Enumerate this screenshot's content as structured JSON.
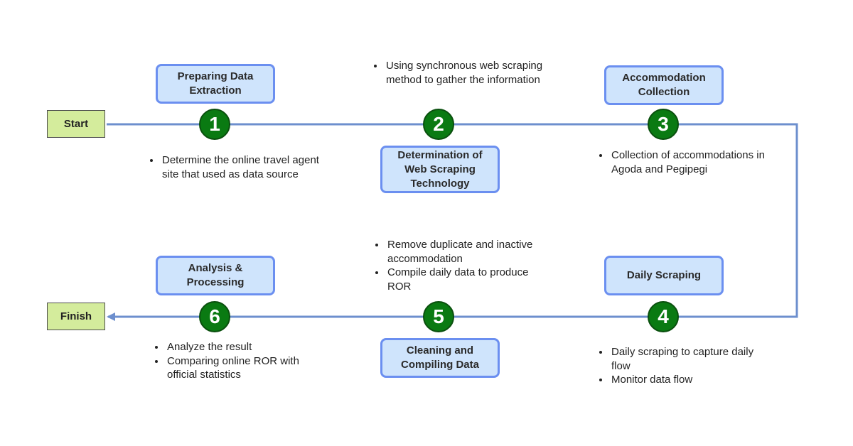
{
  "start_label": "Start",
  "finish_label": "Finish",
  "colors": {
    "connector": "#6d8fce",
    "step_box_fill": "#cfe4fc",
    "step_box_border": "#6b8ff0",
    "circle": "#0a7a12",
    "terminal_fill": "#d4ec9c"
  },
  "steps": [
    {
      "number": "1",
      "title": "Preparing Data Extraction",
      "notes": [
        "Determine the online travel agent site that used as data source"
      ]
    },
    {
      "number": "2",
      "title": "Determination of Web Scraping Technology",
      "notes": [
        "Using synchronous web scraping method to gather the information"
      ]
    },
    {
      "number": "3",
      "title": "Accommodation Collection",
      "notes": [
        "Collection of accommodations in Agoda and Pegipegi"
      ]
    },
    {
      "number": "4",
      "title": "Daily Scraping",
      "notes": [
        "Daily scraping to capture daily flow",
        "Monitor data flow"
      ]
    },
    {
      "number": "5",
      "title": "Cleaning and Compiling Data",
      "notes": [
        "Remove duplicate and inactive accommodation",
        "Compile daily data to produce ROR"
      ]
    },
    {
      "number": "6",
      "title": "Analysis & Processing",
      "notes": [
        "Analyze the result",
        "Comparing online ROR with official statistics"
      ]
    }
  ]
}
